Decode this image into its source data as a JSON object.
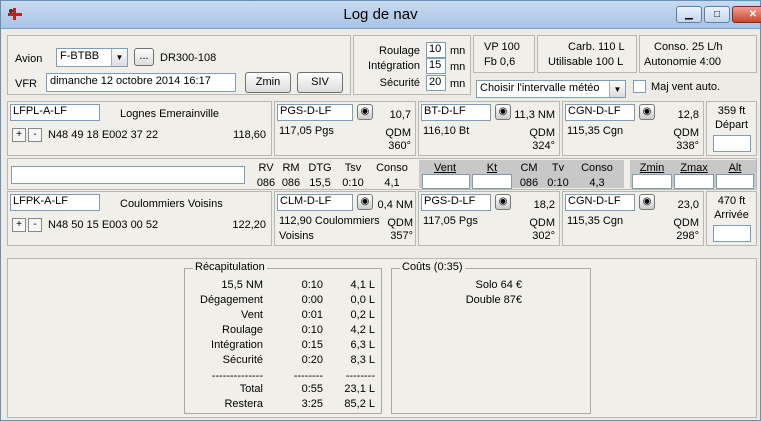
{
  "window": {
    "title": "Log de nav",
    "minimize_icon": "minimize-icon",
    "maximize_icon": "maximize-icon",
    "close_icon": "close-icon"
  },
  "header": {
    "avion_label": "Avion",
    "avion_value": "F-BTBB",
    "browse_label": "...",
    "avion_type": "DR300-108",
    "vfr_label": "VFR",
    "date_value": "dimanche 12 octobre 2014 16:17",
    "zmin_button": "Zmin",
    "siv_button": "SIV",
    "roulage_label": "Roulage",
    "roulage_value": "10",
    "integration_label": "Intégration",
    "integration_value": "15",
    "securite_label": "Sécurité",
    "securite_value": "20",
    "mn": "mn",
    "vp": "VP  100",
    "fb": "Fb  0,6",
    "carb": "Carb.  110 L",
    "utilisable": "Utilisable 100 L",
    "conso": "Conso.  25 L/h",
    "autonomie": "Autonomie  4:00",
    "meteo_select": "Choisir l'intervalle météo",
    "maj_vent_label": "Maj vent auto."
  },
  "departure": {
    "code": "LFPL-A-LF",
    "name": "Lognes Emerainville",
    "coords": "N48 49 18  E002 37 22",
    "freq": "118,60",
    "plus": "+",
    "minus": "-",
    "alt": "359 ft",
    "alt_label": "Départ",
    "navaids": [
      {
        "code": "PGS-D-LF",
        "dist": "10,7",
        "name": "117,05 Pgs",
        "qdm_label": "QDM",
        "qdm": "360°"
      },
      {
        "code": "BT-D-LF",
        "dist": "11,3 NM",
        "name": "116,10 Bt",
        "qdm_label": "QDM",
        "qdm": "324°"
      },
      {
        "code": "CGN-D-LF",
        "dist": "12,8",
        "name": "115,35 Cgn",
        "qdm_label": "QDM",
        "qdm": "338°"
      }
    ]
  },
  "leg": {
    "rv_label": "RV",
    "rv": "086",
    "rm_label": "RM",
    "rm": "086",
    "dtg_label": "DTG",
    "dtg": "15,5",
    "tsv_label": "Tsv",
    "tsv": "0:10",
    "conso_label": "Conso",
    "conso": "4,1",
    "vent_label": "Vent",
    "kt_label": "Kt",
    "cm_label": "CM",
    "cm": "086",
    "tv_label": "Tv",
    "tv": "0:10",
    "conso2_label": "Conso",
    "conso2": "4,3",
    "zmin_label": "Zmin",
    "zmax_label": "Zmax",
    "alt_label": "Alt"
  },
  "arrival": {
    "code": "LFPK-A-LF",
    "name": "Coulommiers Voisins",
    "coords": "N48 50 15  E003 00 52",
    "freq": "122,20",
    "plus": "+",
    "minus": "-",
    "alt": "470 ft",
    "alt_label": "Arrivée",
    "navaids": [
      {
        "code": "CLM-D-LF",
        "dist": "0,4 NM",
        "name": "112,90 Coulommiers",
        "name2": "Voisins",
        "qdm_label": "QDM",
        "qdm": "357°"
      },
      {
        "code": "PGS-D-LF",
        "dist": "18,2",
        "name": "117,05 Pgs",
        "qdm_label": "QDM",
        "qdm": "302°"
      },
      {
        "code": "CGN-D-LF",
        "dist": "23,0",
        "name": "115,35 Cgn",
        "qdm_label": "QDM",
        "qdm": "298°"
      }
    ]
  },
  "recap": {
    "legend": "Récapitulation",
    "rows": [
      {
        "label": "15,5 NM",
        "time": "0:10",
        "fuel": "4,1 L"
      },
      {
        "label": "Dégagement",
        "time": "0:00",
        "fuel": "0,0 L"
      },
      {
        "label": "Vent",
        "time": "0:01",
        "fuel": "0,2 L"
      },
      {
        "label": "Roulage",
        "time": "0:10",
        "fuel": "4,2 L"
      },
      {
        "label": "Intégration",
        "time": "0:15",
        "fuel": "6,3 L"
      },
      {
        "label": "Sécurité",
        "time": "0:20",
        "fuel": "8,3 L"
      }
    ],
    "sep1": "--------------",
    "sep2": "--------",
    "sep3": "--------",
    "total_label": "Total",
    "total_time": "0:55",
    "total_fuel": "23,1 L",
    "restera_label": "Restera",
    "restera_time": "3:25",
    "restera_fuel": "85,2 L"
  },
  "couts": {
    "legend": "Coûts (0:35)",
    "solo": "Solo 64 €",
    "double": "Double 87€"
  }
}
